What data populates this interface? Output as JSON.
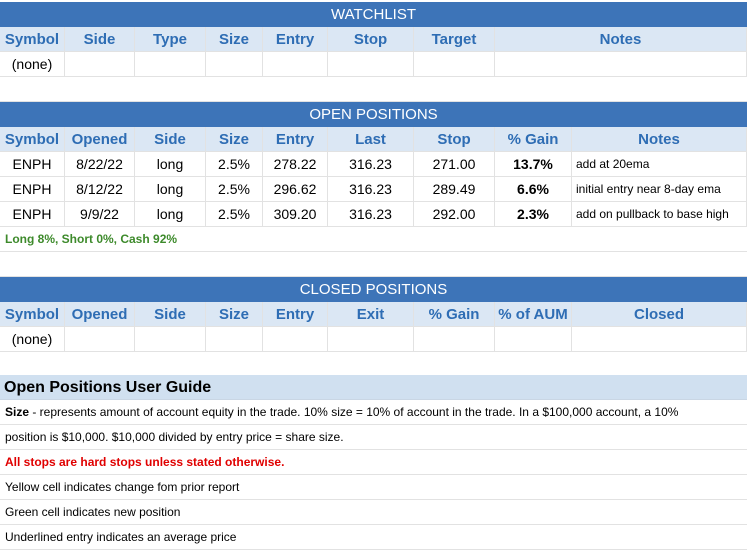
{
  "watchlist": {
    "title": "WATCHLIST",
    "headers": [
      "Symbol",
      "Side",
      "Type",
      "Size",
      "Entry",
      "Stop",
      "Target",
      "Notes"
    ],
    "empty_label": "(none)"
  },
  "open_positions": {
    "title": "OPEN POSITIONS",
    "headers": [
      "Symbol",
      "Opened",
      "Side",
      "Size",
      "Entry",
      "Last",
      "Stop",
      "% Gain",
      "Notes"
    ],
    "rows": [
      {
        "symbol": "ENPH",
        "opened": "8/22/22",
        "side": "long",
        "size": "2.5%",
        "entry": "278.22",
        "last": "316.23",
        "stop": "271.00",
        "gain": "13.7%",
        "notes": "add at 20ema"
      },
      {
        "symbol": "ENPH",
        "opened": "8/12/22",
        "side": "long",
        "size": "2.5%",
        "entry": "296.62",
        "last": "316.23",
        "stop": "289.49",
        "gain": "6.6%",
        "notes": "initial entry near 8-day ema"
      },
      {
        "symbol": "ENPH",
        "opened": "9/9/22",
        "side": "long",
        "size": "2.5%",
        "entry": "309.20",
        "last": "316.23",
        "stop": "292.00",
        "gain": "2.3%",
        "notes": "add on pullback to base high"
      }
    ],
    "allocation": "Long 8%, Short 0%, Cash 92%"
  },
  "closed_positions": {
    "title": "CLOSED POSITIONS",
    "headers": [
      "Symbol",
      "Opened",
      "Side",
      "Size",
      "Entry",
      "Exit",
      "% Gain",
      "% of AUM",
      "Closed"
    ],
    "empty_label": "(none)"
  },
  "guide": {
    "title": "Open Positions User Guide",
    "size_term": "Size",
    "size_text_1": " - represents amount of account equity in the trade.  10% size = 10% of account in the trade.  In a $100,000 account, a 10%",
    "size_text_2": "position is $10,000.  $10,000 divided by entry price = share size.",
    "stops_note": "All stops are hard stops unless stated otherwise.",
    "yellow_note": "Yellow cell indicates change fom prior report",
    "green_note": "Green cell indicates new position",
    "underline_note": "Underlined entry indicates an average price"
  },
  "colors": {
    "band": "#3d74b8",
    "header_bg": "#dbe7f4",
    "header_text": "#2e6db4",
    "allocation_text": "#3d8a2b",
    "alert_text": "#e00000"
  }
}
